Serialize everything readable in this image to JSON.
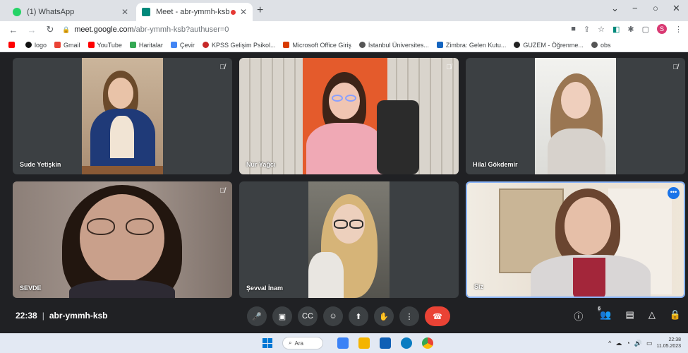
{
  "browser": {
    "tabs": [
      {
        "title": "(1) WhatsApp",
        "favicon_color": "#25d366"
      },
      {
        "title": "Meet - abr-ymmh-ksb",
        "favicon_color": "#00897b"
      }
    ],
    "new_tab": "+",
    "address": {
      "host": "meet.google.com",
      "path": "/abr-ymmh-ksb?authuser=0"
    },
    "profile_initial": "S",
    "bookmarks": [
      {
        "label": "logo",
        "color": "#111"
      },
      {
        "label": "Gmail",
        "color": "#ea4335"
      },
      {
        "label": "YouTube",
        "color": "#ff0000"
      },
      {
        "label": "Haritalar",
        "color": "#34a853"
      },
      {
        "label": "Çevir",
        "color": "#4285f4"
      },
      {
        "label": "KPSS Gelişim Psikol...",
        "color": "#c62828"
      },
      {
        "label": "Microsoft Office Giriş",
        "color": "#d83b01"
      },
      {
        "label": "İstanbul Üniversites...",
        "color": "#555"
      },
      {
        "label": "Zimbra: Gelen Kutu...",
        "color": "#1565c0"
      },
      {
        "label": "GUZEM - Öğrenme...",
        "color": "#222"
      },
      {
        "label": "obs",
        "color": "#555"
      }
    ]
  },
  "participants": [
    {
      "name": "Sude Yetişkin",
      "muted": true
    },
    {
      "name": "Nur Yağcı",
      "muted": true
    },
    {
      "name": "Hilal Gökdemir",
      "muted": true
    },
    {
      "name": "SEVDE",
      "muted": true
    },
    {
      "name": "Şevval İnam",
      "muted": false
    },
    {
      "name": "Siz",
      "muted": false
    }
  ],
  "meeting": {
    "time": "22:38",
    "code": "abr-ymmh-ksb",
    "people_count": "6"
  },
  "taskbar": {
    "search": "Ara",
    "clock_time": "22:38",
    "clock_date": "11.05.2023"
  }
}
